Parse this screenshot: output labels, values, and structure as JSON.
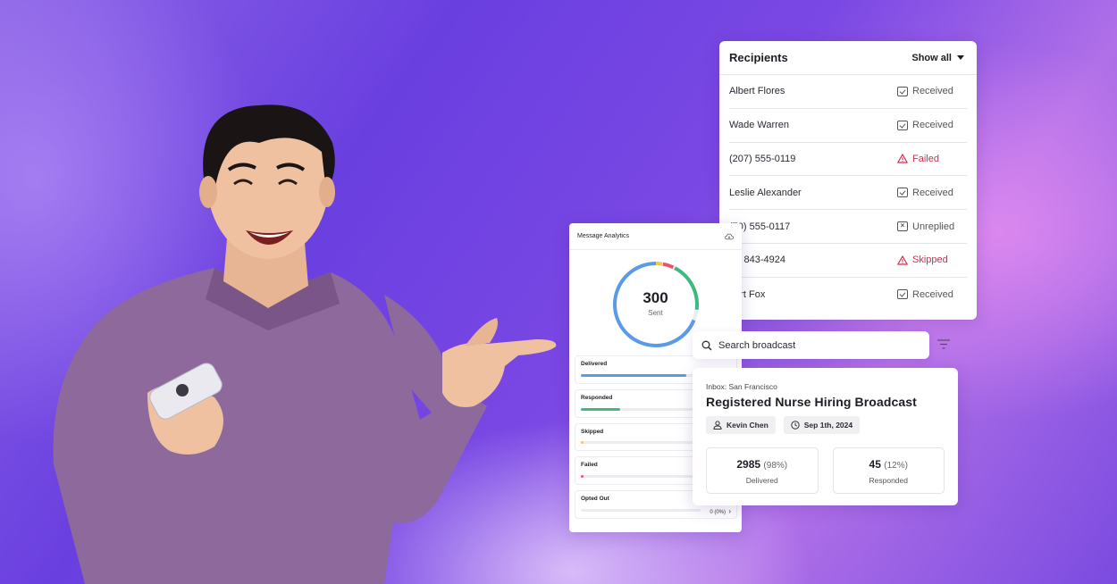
{
  "colors": {
    "delivered": "#5a9ae8",
    "responded": "#3fb97e",
    "skipped": "#f2c94c",
    "failed": "#e8546b",
    "warning": "#d62b4d"
  },
  "recipients": {
    "title": "Recipients",
    "filter_label": "Show all",
    "rows": [
      {
        "name": "Albert Flores",
        "status": "Received",
        "icon": "message-check-icon"
      },
      {
        "name": "Wade Warren",
        "status": "Received",
        "icon": "message-check-icon"
      },
      {
        "name": "(207) 555-0119",
        "status": "Failed",
        "icon": "warning-icon"
      },
      {
        "name": "Leslie Alexander",
        "status": "Received",
        "icon": "message-check-icon"
      },
      {
        "name": "(70) 555-0117",
        "status": "Unreplied",
        "icon": "message-x-icon"
      },
      {
        "name": "(3) 843-4924",
        "status": "Skipped",
        "icon": "warning-icon"
      },
      {
        "name": "bert Fox",
        "status": "Received",
        "icon": "message-check-icon"
      }
    ]
  },
  "analytics": {
    "title": "Message Analytics",
    "total": "300",
    "total_label": "Sent",
    "stats": [
      {
        "label": "Delivered",
        "fraction": 0.88,
        "color": "#5a9ae8",
        "value": ""
      },
      {
        "label": "Responded",
        "fraction": 0.33,
        "color": "#3fb97e",
        "value": ""
      },
      {
        "label": "Skipped",
        "fraction": 0.02,
        "color": "#f2c94c",
        "value": ""
      },
      {
        "label": "Failed",
        "fraction": 0.02,
        "color": "#e8546b",
        "value": ""
      },
      {
        "label": "Opted Out",
        "fraction": 0,
        "color": "#cccccc",
        "value": "0 (0%)"
      }
    ]
  },
  "search": {
    "placeholder": "Search broadcast"
  },
  "broadcast": {
    "inbox": "Inbox: San Francisco",
    "title": "Registered Nurse Hiring Broadcast",
    "owner": "Kevin Chen",
    "date": "Sep 1th, 2024",
    "delivered_count": "2985",
    "delivered_pct": "(98%)",
    "delivered_label": "Delivered",
    "responded_count": "45",
    "responded_pct": "(12%)",
    "responded_label": "Responded"
  }
}
